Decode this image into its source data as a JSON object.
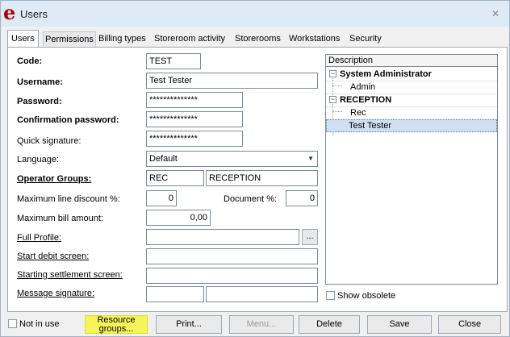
{
  "window": {
    "title": "Users",
    "logo": "e"
  },
  "tabs": [
    {
      "label": "Users"
    },
    {
      "label": "Permissions"
    },
    {
      "label": "Billing types"
    },
    {
      "label": "Storeroom activity"
    },
    {
      "label": "Storerooms"
    },
    {
      "label": "Workstations"
    },
    {
      "label": "Security"
    }
  ],
  "form": {
    "code_label": "Code:",
    "code_value": "TEST",
    "username_label": "Username:",
    "username_value": "Test Tester",
    "password_label": "Password:",
    "password_value": "**************",
    "confirm_label": "Confirmation password:",
    "confirm_value": "**************",
    "quick_label": "Quick signature:",
    "quick_value": "**************",
    "language_label": "Language:",
    "language_value": "Default",
    "groups_label": "Operator Groups:",
    "groups_code": "REC",
    "groups_name": "RECEPTION",
    "max_discount_label": "Maximum line discount %:",
    "max_discount_value": "0",
    "document_label": "Document %:",
    "document_value": "0",
    "max_bill_label": "Maximum bill amount:",
    "max_bill_value": "0,00",
    "full_profile_label": "Full Profile:",
    "full_profile_value": "",
    "ellipsis": "...",
    "start_debit_label": "Start debit screen:",
    "start_debit_value": "",
    "start_settle_label": "Starting settlement screen:",
    "start_settle_value": "",
    "message_sig_label": "Message signature:",
    "message_sig_value1": "",
    "message_sig_value2": ""
  },
  "tree": {
    "header": "Description",
    "groups": [
      {
        "name": "System Administrator",
        "expander": "−",
        "children": [
          "Admin"
        ]
      },
      {
        "name": "RECEPTION",
        "expander": "−",
        "children": [
          "Rec",
          "Test Tester"
        ]
      }
    ],
    "selected": "Test Tester",
    "show_obsolete_label": "Show obsolete"
  },
  "footer": {
    "not_in_use_label": "Not in use",
    "resource_line1": "Resource",
    "resource_line2": "groups...",
    "print_label": "Print...",
    "menu_label": "Menu...",
    "delete_label": "Delete",
    "save_label": "Save",
    "close_label": "Close"
  },
  "colors": {
    "accent_highlight": "#f5f55a",
    "logo_red": "#b30000",
    "selection": "#cfe0f3"
  }
}
